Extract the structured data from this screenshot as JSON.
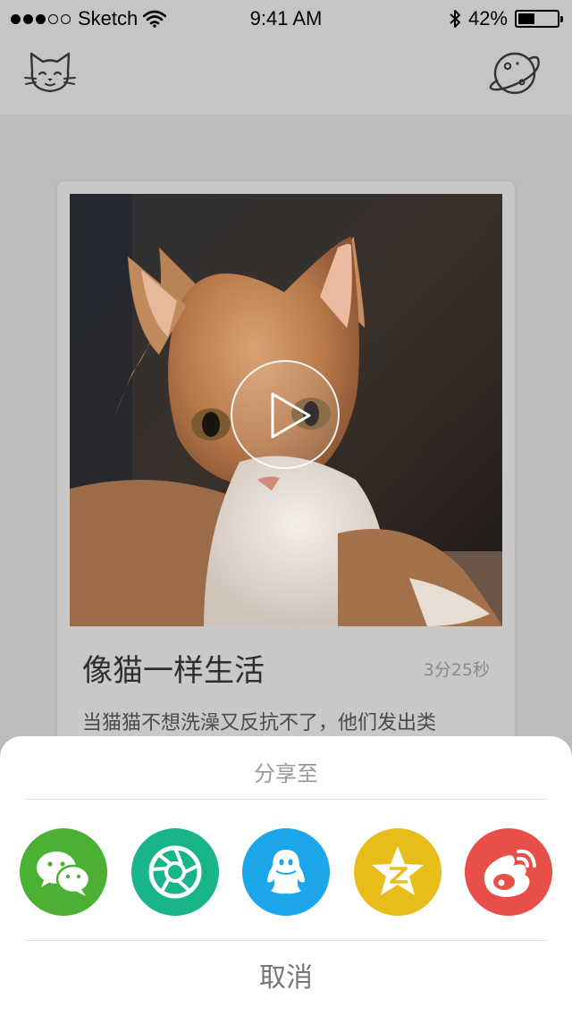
{
  "status_bar": {
    "carrier": "Sketch",
    "time": "9:41 AM",
    "battery": "42%",
    "battery_level": 0.42,
    "signal_dots_filled": 3,
    "signal_dots_total": 5
  },
  "nav": {
    "left_icon": "cat-icon",
    "right_icon": "planet-icon"
  },
  "card": {
    "title": "像猫一样生活",
    "duration": "3分25秒",
    "description": "当猫猫不想洗澡又反抗不了，他们发出类"
  },
  "share_sheet": {
    "title": "分享至",
    "cancel_label": "取消",
    "targets": [
      {
        "icon": "wechat-icon",
        "color": "#4cb035"
      },
      {
        "icon": "moments-icon",
        "color": "#18b48a"
      },
      {
        "icon": "qq-icon",
        "color": "#1ba6ea"
      },
      {
        "icon": "qzone-icon",
        "color": "#e8bd1a"
      },
      {
        "icon": "weibo-icon",
        "color": "#e84f48"
      }
    ]
  }
}
